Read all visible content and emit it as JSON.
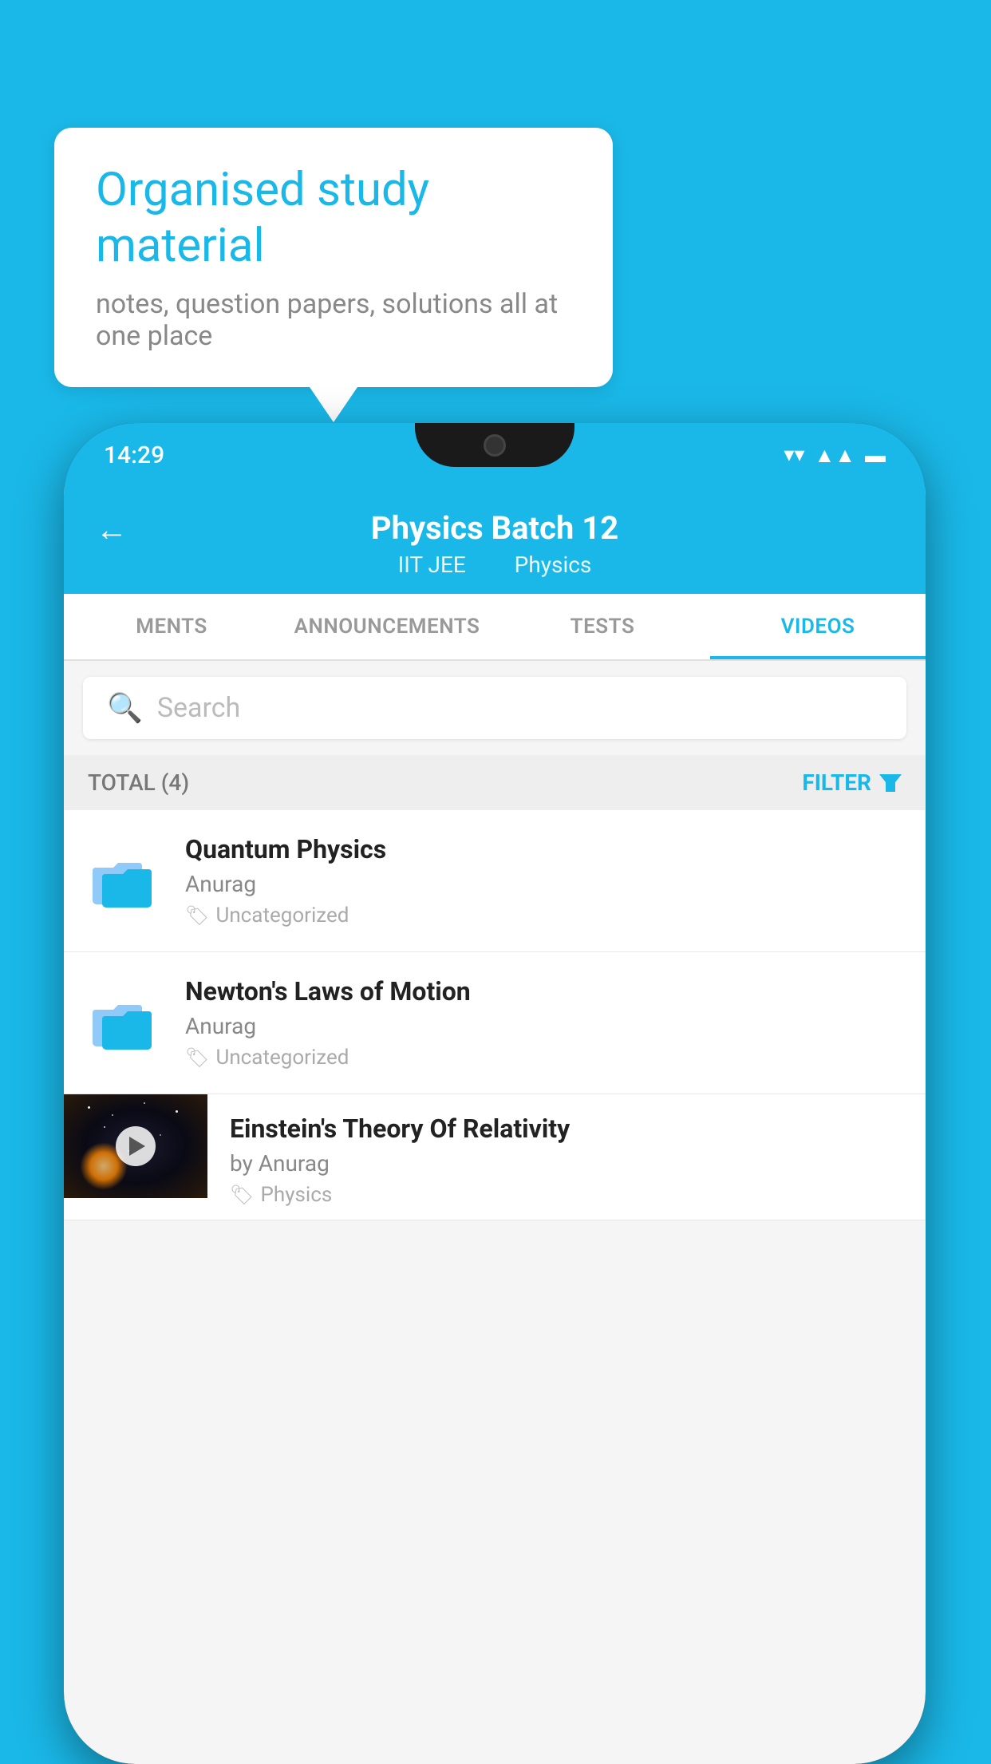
{
  "background_color": "#1ab8e8",
  "speech_bubble": {
    "title": "Organised study material",
    "subtitle": "notes, question papers, solutions all at one place"
  },
  "phone": {
    "status_bar": {
      "time": "14:29",
      "icons": [
        "wifi",
        "signal",
        "battery"
      ]
    },
    "header": {
      "back_label": "←",
      "title": "Physics Batch 12",
      "subtitle_part1": "IIT JEE",
      "subtitle_part2": "Physics"
    },
    "tabs": [
      {
        "label": "MENTS",
        "active": false
      },
      {
        "label": "ANNOUNCEMENTS",
        "active": false
      },
      {
        "label": "TESTS",
        "active": false
      },
      {
        "label": "VIDEOS",
        "active": true
      }
    ],
    "search": {
      "placeholder": "Search"
    },
    "filter_bar": {
      "total_label": "TOTAL (4)",
      "filter_label": "FILTER"
    },
    "video_items": [
      {
        "id": 1,
        "type": "folder",
        "title": "Quantum Physics",
        "author": "Anurag",
        "tag": "Uncategorized"
      },
      {
        "id": 2,
        "type": "folder",
        "title": "Newton's Laws of Motion",
        "author": "Anurag",
        "tag": "Uncategorized"
      },
      {
        "id": 3,
        "type": "video",
        "title": "Einstein's Theory Of Relativity",
        "author": "by Anurag",
        "tag": "Physics"
      }
    ]
  }
}
